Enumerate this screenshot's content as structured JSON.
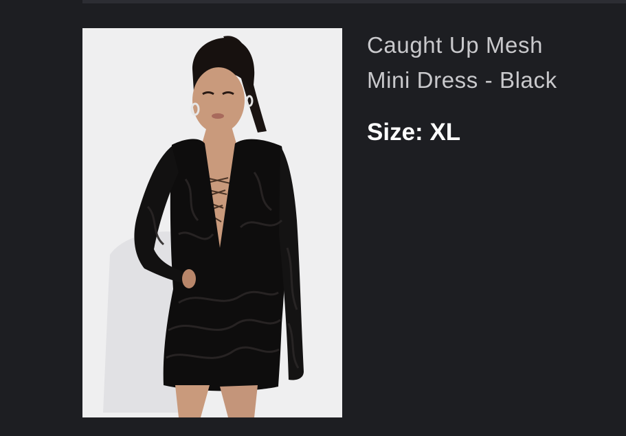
{
  "product": {
    "title_line_1": "Caught Up Mesh",
    "title_line_2": "Mini Dress - Black",
    "size_label": "Size:",
    "size_value": "XL"
  },
  "colors": {
    "background": "#1d1e22",
    "title_text": "#c9c9cc",
    "size_text": "#ffffff",
    "photo_background": "#efeff0"
  }
}
